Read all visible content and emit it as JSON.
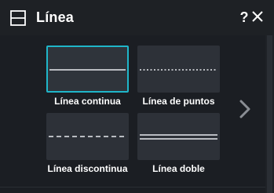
{
  "window": {
    "title": "Línea",
    "title_icon": "line-style-icon",
    "help_label": "?",
    "close_icon": "close-icon"
  },
  "accent_color": "#1fb6c9",
  "line_styles": [
    {
      "label": "Línea continua",
      "style": "solid",
      "selected": true
    },
    {
      "label": "Línea de puntos",
      "style": "dotted",
      "selected": false
    },
    {
      "label": "Línea discontinua",
      "style": "dashed",
      "selected": false
    },
    {
      "label": "Línea doble",
      "style": "double",
      "selected": false
    }
  ],
  "navigation": {
    "next_icon": "chevron-right-icon"
  }
}
